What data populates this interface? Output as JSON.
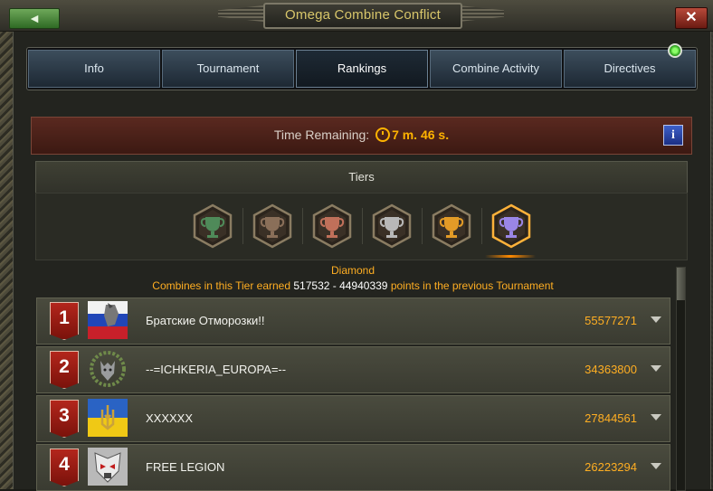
{
  "window": {
    "title": "Omega Combine Conflict",
    "back_label": "◄",
    "close_label": "✕"
  },
  "tabs": [
    {
      "label": "Info"
    },
    {
      "label": "Tournament"
    },
    {
      "label": "Rankings",
      "active": true
    },
    {
      "label": "Combine Activity"
    },
    {
      "label": "Directives"
    }
  ],
  "timer": {
    "label": "Time Remaining:",
    "value": "7 m. 46 s.",
    "info_label": "i"
  },
  "tiers": {
    "header": "Tiers",
    "items": [
      {
        "name": "green-trophy-icon",
        "color": "#4f8a59",
        "selected": false
      },
      {
        "name": "bronze-trophy-icon",
        "color": "#8a6f59",
        "selected": false
      },
      {
        "name": "copper-trophy-icon",
        "color": "#c0705a",
        "selected": false
      },
      {
        "name": "silver-trophy-icon",
        "color": "#b8b8b8",
        "selected": false
      },
      {
        "name": "gold-trophy-icon",
        "color": "#e39b27",
        "selected": false
      },
      {
        "name": "diamond-trophy-icon",
        "color": "#9a86e6",
        "selected": true
      }
    ],
    "selected_name": "Diamond",
    "desc_prefix": "Combines in this Tier earned",
    "desc_range": "517532 - 44940339",
    "desc_suffix": "points in the previous Tournament"
  },
  "rankings": [
    {
      "rank": "1",
      "name": "Братские Отморозки!!",
      "points": "55577271",
      "emblem": "russian-flag-emblem-icon"
    },
    {
      "rank": "2",
      "name": "--=ICHKERIA_EUROPA=--",
      "points": "34363800",
      "emblem": "wolf-laurel-emblem-icon"
    },
    {
      "rank": "3",
      "name": "XXXXXX",
      "points": "27844561",
      "emblem": "ukraine-trident-emblem-icon"
    },
    {
      "rank": "4",
      "name": "FREE LEGION",
      "points": "26223294",
      "emblem": "skull-emblem-icon"
    }
  ],
  "colors": {
    "accent": "#ffae22",
    "rank_badge": "#b3261c",
    "timer_bg": "#5a2920"
  }
}
